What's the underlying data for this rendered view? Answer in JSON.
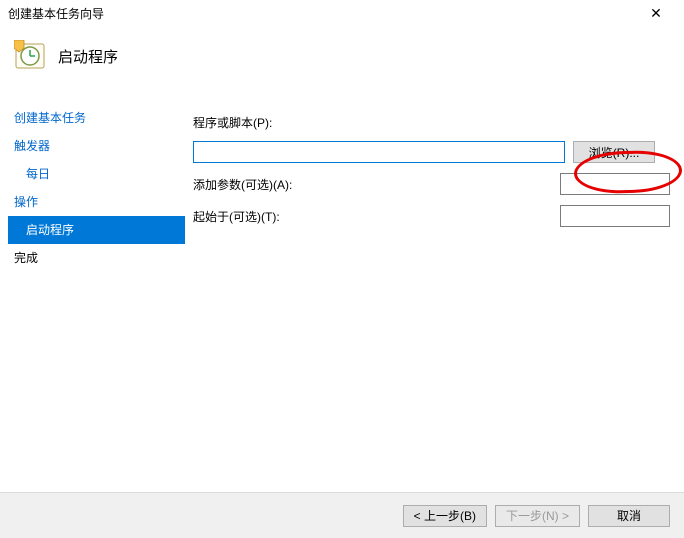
{
  "window": {
    "title": "创建基本任务向导"
  },
  "header": {
    "title": "启动程序"
  },
  "sidebar": {
    "items": [
      {
        "label": "创建基本任务",
        "kind": "link"
      },
      {
        "label": "触发器",
        "kind": "link"
      },
      {
        "label": "每日",
        "kind": "link-sub"
      },
      {
        "label": "操作",
        "kind": "link"
      },
      {
        "label": "启动程序",
        "kind": "selected-sub"
      },
      {
        "label": "完成",
        "kind": "plain"
      }
    ]
  },
  "form": {
    "program_label": "程序或脚本(P):",
    "program_value": "",
    "browse_label": "浏览(R)...",
    "args_label": "添加参数(可选)(A):",
    "args_value": "",
    "startin_label": "起始于(可选)(T):",
    "startin_value": ""
  },
  "footer": {
    "back": "< 上一步(B)",
    "next": "下一步(N) >",
    "cancel": "取消"
  }
}
